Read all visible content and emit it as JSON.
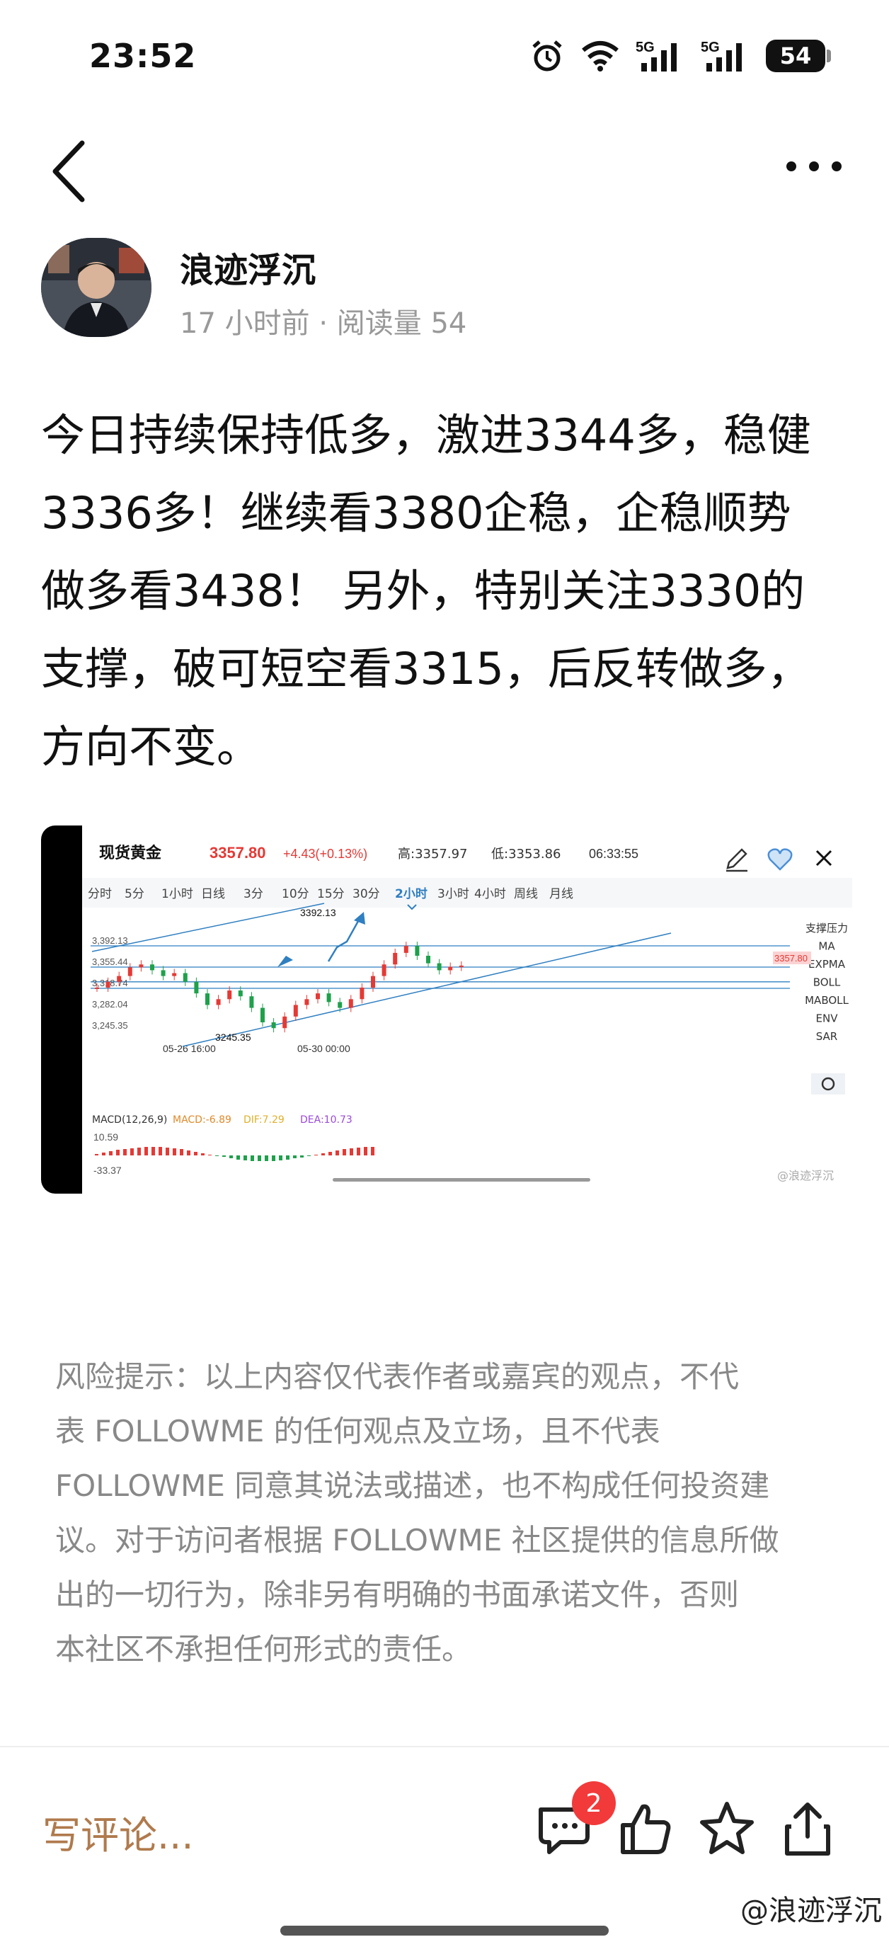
{
  "status": {
    "time": "23:52",
    "battery": "54",
    "net1": "5G",
    "net2": "5G"
  },
  "author": {
    "name": "浪迹浮沉",
    "meta": "17 小时前 · 阅读量 54"
  },
  "post": {
    "lines": [
      "今日持续保持低多，激进3344多，稳健",
      "3336多！继续看3380企稳，企稳顺势",
      "做多看3438！ 另外，特别关注3330的",
      "支撑，破可短空看3315，后反转做多，",
      "方向不变。"
    ]
  },
  "chart": {
    "header": {
      "symbol": "现货黄金",
      "price": "3357.80",
      "change": "+4.43(+0.13%)",
      "high": "高:3357.97",
      "low": "低:3353.86",
      "time": "06:33:55"
    },
    "timeframes": [
      "分时",
      "5分",
      "1小时",
      "日线",
      "3分",
      "10分",
      "15分",
      "30分",
      "2小时",
      "3小时",
      "4小时",
      "周线",
      "月线"
    ],
    "active_timeframe": "2小时",
    "indicators": [
      "支撑压力",
      "MA",
      "EXPMA",
      "BOLL",
      "MABOLL",
      "ENV",
      "SAR"
    ],
    "y_labels": [
      "3,392.13",
      "3,355.44",
      "3,318.74",
      "3,282.04",
      "3,245.35"
    ],
    "x_labels": [
      "05-26 16:00",
      "05-30 00:00"
    ],
    "annotations": {
      "high": "3392.13",
      "low": "3245.35",
      "current": "3357.80"
    },
    "macd": {
      "label": "MACD(12,26,9)",
      "macd": "MACD:-6.89",
      "dif": "DIF:7.29",
      "dea": "DEA:10.73",
      "top": "10.59",
      "bottom": "-33.37"
    },
    "watermark": "@浪迹浮沉",
    "colors": {
      "up": "#e53935",
      "down": "#1ea14b",
      "trend_line": "#2f7fc1",
      "price": "#e53935"
    }
  },
  "disclaimer": {
    "lines": [
      "风险提示：以上内容仅代表作者或嘉宾的观点，不代",
      "表 FOLLOWME 的任何观点及立场，且不代表",
      "FOLLOWME 同意其说法或描述，也不构成任何投资建",
      "议。对于访问者根据 FOLLOWME 社区提供的信息所做",
      "出的一切行为，除非另有明确的书面承诺文件，否则",
      "本社区不承担任何形式的责任。"
    ]
  },
  "bottom": {
    "comment_placeholder": "写评论...",
    "comment_count": "2",
    "watermark": "@浪迹浮沉"
  }
}
